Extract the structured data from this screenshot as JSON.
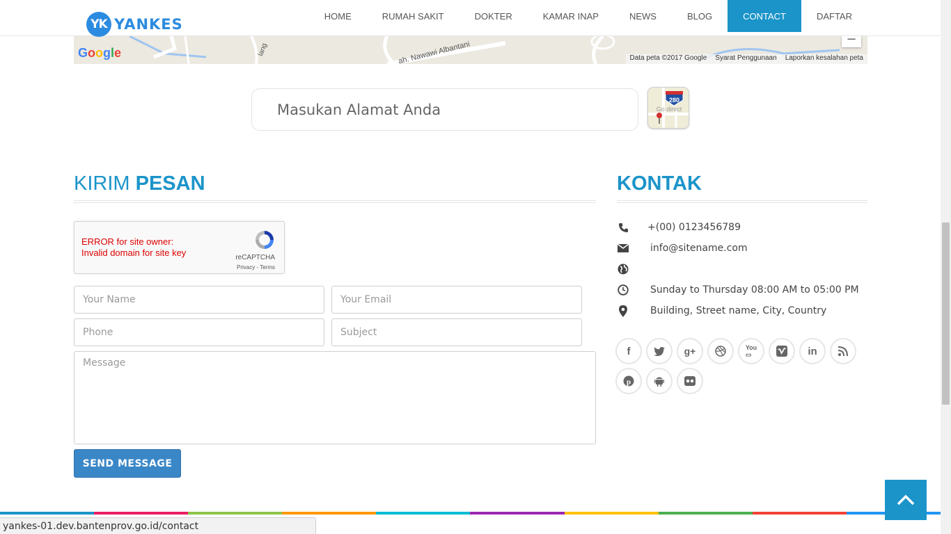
{
  "header": {
    "logo_badge": "YK",
    "logo_text": "YANKES",
    "nav": [
      {
        "label": "HOME"
      },
      {
        "label": "RUMAH SAKIT"
      },
      {
        "label": "DOKTER"
      },
      {
        "label": "KAMAR INAP"
      },
      {
        "label": "NEWS"
      },
      {
        "label": "BLOG"
      },
      {
        "label": "CONTACT",
        "active": true
      },
      {
        "label": "DAFTAR"
      }
    ]
  },
  "map": {
    "google_label": "Google",
    "zoom_out": "−",
    "street_1": "lang",
    "street_2": "ah. Nawawi Albantani",
    "credits": [
      "Data peta ©2017 Google",
      "Syarat Penggunaan",
      "Laporkan kesalahan peta"
    ]
  },
  "address": {
    "placeholder": "Masukan Alamat Anda",
    "map_icon_badge": "280",
    "map_icon_text": "Go direct"
  },
  "form": {
    "title_light": "KIRIM ",
    "title_bold": "PESAN",
    "recaptcha": {
      "error_line1": "ERROR for site owner:",
      "error_line2": "Invalid domain for site key",
      "brand": "reCAPTCHA",
      "links": "Privacy - Terms"
    },
    "name_placeholder": "Your Name",
    "email_placeholder": "Your Email",
    "phone_placeholder": "Phone",
    "subject_placeholder": "Subject",
    "message_placeholder": "Message",
    "send_label": "SEND MESSAGE"
  },
  "contact": {
    "title": "KONTAK",
    "phone": "+(00) 0123456789",
    "email": "info@sitename.com",
    "website": "",
    "hours": "Sunday to Thursday 08:00 AM to 05:00 PM",
    "address": "Building, Street name, City, Country",
    "icons": [
      "phone-icon",
      "envelope-icon",
      "globe-icon",
      "clock-icon",
      "map-marker-icon"
    ]
  },
  "social": [
    "facebook",
    "twitter",
    "google-plus",
    "dribbble",
    "youtube",
    "vimeo",
    "linkedin",
    "rss",
    "pinterest",
    "android",
    "flickr"
  ],
  "stripe_colors": [
    "#1b94c9",
    "#e91e63",
    "#8bc34a",
    "#ff9800",
    "#00bcd4",
    "#9c27b0",
    "#ffc107",
    "#4caf50",
    "#f44336",
    "#2196f3"
  ],
  "status_bar": {
    "url": "yankes-01.dev.bantenprov.go.id/contact"
  }
}
